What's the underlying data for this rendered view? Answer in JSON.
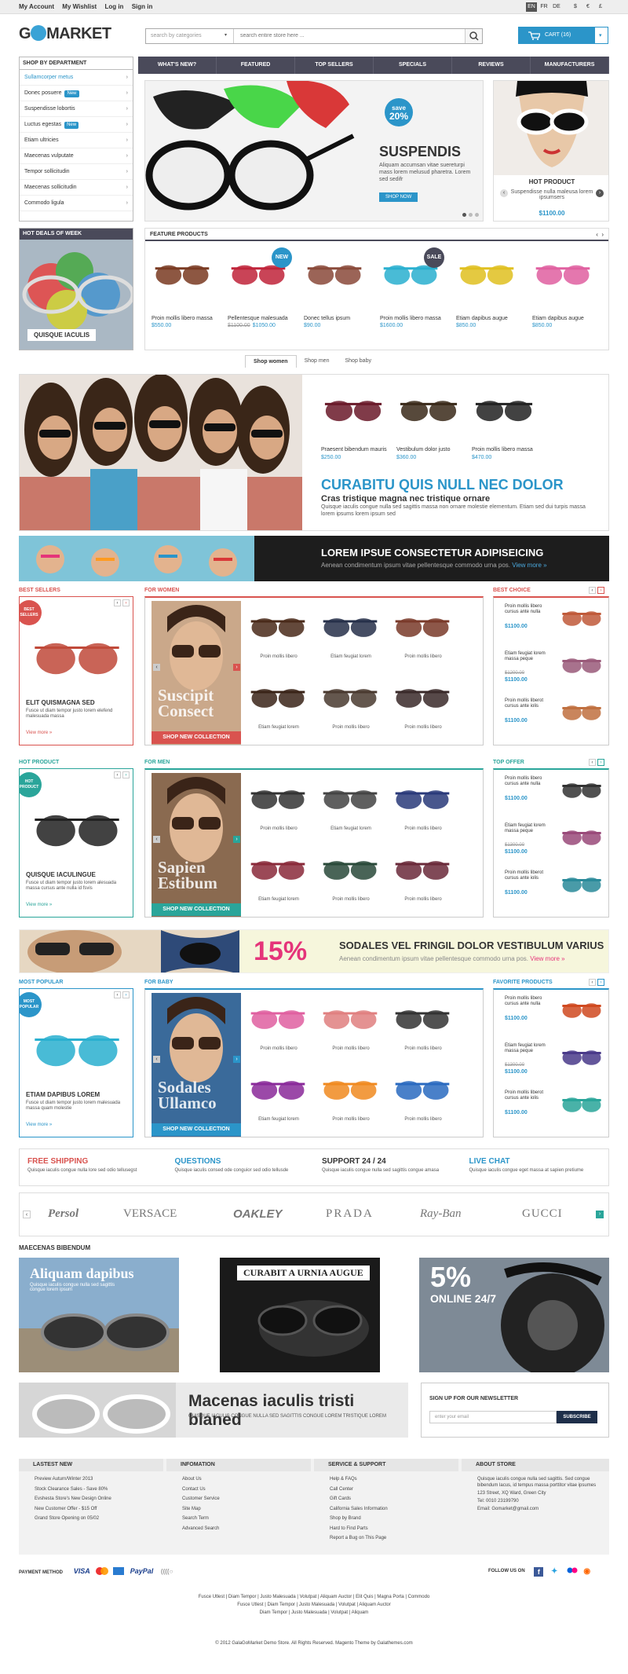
{
  "topbar": {
    "account": "My Account",
    "wishlist": "My Wishlist",
    "login": "Log in",
    "signin": "Sign in",
    "langs": [
      "EN",
      "FR",
      "DE"
    ],
    "currencies": [
      "$",
      "€",
      "£"
    ]
  },
  "logo": {
    "g": "G",
    "rest": "MARKET"
  },
  "search": {
    "category_placeholder": "search by categories",
    "placeholder": "search entire store here ..."
  },
  "cart": {
    "label": "CART (16)"
  },
  "dept": {
    "title": "SHOP BY DEPARTMENT",
    "items": [
      {
        "label": "Sullamcorper metus",
        "active": true,
        "badge": ""
      },
      {
        "label": "Donec posuere",
        "badge": "New"
      },
      {
        "label": "Suspendisse lobortis",
        "badge": ""
      },
      {
        "label": "Luctus egestas",
        "badge": "New"
      },
      {
        "label": "Etiam ultricies",
        "badge": ""
      },
      {
        "label": "Maecenas vulputate",
        "badge": ""
      },
      {
        "label": "Tempor sollicitudin",
        "badge": ""
      },
      {
        "label": "Maecenas sollicitudin",
        "badge": ""
      },
      {
        "label": "Commodo ligula",
        "badge": ""
      }
    ]
  },
  "nav": [
    "WHAT'S NEW?",
    "FEATURED",
    "TOP SELLERS",
    "SPECIALS",
    "REVIEWS",
    "MANUFACTURERS"
  ],
  "hero": {
    "save_top": "save",
    "save_pct": "20%",
    "title": "SUSPENDIS",
    "desc": "Aliquam accumsan vitae suereturpi mass lorem melusud pharetra. Lorem sed sedifr",
    "button": "SHOP NOW"
  },
  "hot_product": {
    "title": "HOT PRODUCT",
    "desc": "Suspendisse nulla maleusa lorem ipsumsers",
    "price": "$1100.00"
  },
  "hot_deals": {
    "title": "HOT DEALS OF WEEK",
    "caption": "QUISQUE IACULIS"
  },
  "feature": {
    "title": "FEATURE PRODUCTS",
    "products": [
      {
        "name": "Proin mollis libero massa",
        "price": "$550.00",
        "old": "",
        "badge": "",
        "color": "#7a3a22"
      },
      {
        "name": "Pellentesque malesuada",
        "price": "$1050.00",
        "old": "$1100.00",
        "badge": "NEW",
        "color": "#c0243a"
      },
      {
        "name": "Donec tellus ipsum",
        "price": "$90.00",
        "old": "",
        "badge": "",
        "color": "#8a4a3a"
      },
      {
        "name": "Proin mollis libero massa",
        "price": "$1600.00",
        "old": "",
        "badge": "SALE",
        "color": "#2ab0d0"
      },
      {
        "name": "Etiam dapibus augue",
        "price": "$850.00",
        "old": "",
        "badge": "",
        "color": "#e0c020"
      },
      {
        "name": "Etiam dapibus augue",
        "price": "$850.00",
        "old": "",
        "badge": "",
        "color": "#e060a0"
      }
    ]
  },
  "shop_tabs": [
    "Shop women",
    "Shop men",
    "Shop baby"
  ],
  "banner": {
    "products": [
      {
        "name": "Praesent bibendum mauris",
        "price": "$250.00"
      },
      {
        "name": "Vestibulum dolor justo",
        "price": "$360.00"
      },
      {
        "name": "Proin mollis libero massa",
        "price": "$470.00"
      }
    ],
    "title": "CURABITU QUIS NULL NEC DOLOR",
    "subtitle": "Cras tristique magna nec tristique ornare",
    "desc": "Quisque iaculis congue nulla sed sagittis massa non ornare molestie elementum. Etiam sed dui turpis massa lorem ipsums lorem ipsum sed"
  },
  "stripe": {
    "title": "LOREM IPSUE CONSECTETUR ADIPISEICING",
    "sub": "Aenean condimentum ipsum vitae pellentesque commodo urna pos.",
    "more": "View more »"
  },
  "sections": [
    {
      "left_label": "BEST SELLERS",
      "left_color": "#d9534f",
      "left_ribbon": "BEST SELLERS",
      "left_name": "ELIT QUISMAGNA SED",
      "left_desc": "Fusce ut diam tempor justo lorem elefend malesuada massa",
      "view": "View more »",
      "mid_label": "FOR WOMEN",
      "mid_caption": "Suscipit Consect",
      "mid_btn": "SHOP NEW COLLECTION",
      "grid": [
        "Proin mollis libero",
        "Etiam feugiat lorem",
        "Proin mollis libero",
        "Etiam feugiat lorem",
        "Proin mollis libero",
        "Proin mollis libero"
      ],
      "right_label": "BEST CHOICE",
      "side": [
        {
          "name": "Proin mollis libero cursus ante nulla",
          "old": "",
          "price": "$1100.00"
        },
        {
          "name": "Etiam feugiat lorem massa peque",
          "old": "$1200.00",
          "price": "$1100.00"
        },
        {
          "name": "Proin mollis liberot cursus ante iolis",
          "old": "",
          "price": "$1100.00"
        }
      ]
    },
    {
      "left_label": "HOT PRODUCT",
      "left_color": "#2aa59a",
      "left_ribbon": "HOT PRODUCT",
      "left_name": "QUISQUE IACULINGUE",
      "left_desc": "Fusce ut diam tempor justo lorem alesuada massa cursus ante nulla id fsvis",
      "view": "View more »",
      "mid_label": "FOR MEN",
      "mid_caption": "Sapien Estibum",
      "mid_btn": "SHOP NEW COLLECTION",
      "grid": [
        "Proin mollis libero",
        "Etiam feugiat lorem",
        "Proin mollis libero",
        "Etiam feugiat lorem",
        "Proin mollis libero",
        "Proin mollis libero"
      ],
      "right_label": "TOP OFFER",
      "side": [
        {
          "name": "Proin mollis libero cursus ante nulla",
          "old": "",
          "price": "$1100.00"
        },
        {
          "name": "Etiam feugiat lorem massa peque",
          "old": "$1300.00",
          "price": "$1100.00"
        },
        {
          "name": "Proin mollis liberot cursus ante iolis",
          "old": "",
          "price": "$1100.00"
        }
      ]
    },
    {
      "left_label": "MOST POPULAR",
      "left_color": "#2b95c9",
      "left_ribbon": "MOST POPULAR",
      "left_name": "ETIAM DAPIBUS LOREM",
      "left_desc": "Fusce ut diam tempor justo lorem malesuada massa quam molestie",
      "view": "View more »",
      "mid_label": "FOR BABY",
      "mid_caption": "Sodales Ullamco",
      "mid_btn": "SHOP NEW COLLECTION",
      "grid": [
        "Proin mollis libero",
        "Proin mollis libero",
        "Proin mollis libero",
        "Etiam feugiat lorem",
        "Proin mollis libero",
        "Proin mollis libero"
      ],
      "right_label": "FAVORITE PRODUCTS",
      "side": [
        {
          "name": "Proin mollis libero cursus ante nulla",
          "old": "",
          "price": "$1100.00"
        },
        {
          "name": "Etiam feugiat lorem massa peque",
          "old": "$1300.00",
          "price": "$1100.00"
        },
        {
          "name": "Proin mollis liberot cursus ante iolis",
          "old": "",
          "price": "$1100.00"
        }
      ]
    }
  ],
  "promo": {
    "pct": "15%",
    "title": "SODALES VEL FRINGIL DOLOR VESTIBULUM VARIUS",
    "sub": "Aenean condimentum ipsum vitae pellentesque commodo urna pos.",
    "more": "View more »"
  },
  "services": [
    {
      "t": "FREE SHIPPING",
      "d": "Quisque iaculis congue nulla lore sed odio tellusegst"
    },
    {
      "t": "QUESTIONS",
      "d": "Quisque iaculis consed ode  conguior sed odio tellusde"
    },
    {
      "t": "SUPPORT 24 / 24",
      "d": "Quisque iaculis congue nulla sed sagittis congue  amasa"
    },
    {
      "t": "LIVE CHAT",
      "d": "Quisque iaculis congue  eget massa at sapien pretiume"
    }
  ],
  "brands": [
    "Persol",
    "VERSACE",
    "OAKLEY",
    "PRADA",
    "Ray-Ban",
    "GUCCI"
  ],
  "maecenas": {
    "title": "MAECENAS BIBENDUM",
    "p1": "Aliquam dapibus",
    "p1d": "Quisque iaculis congue nulla sed sagittis congue lorem ipsum",
    "p2": "CURABIT A URNIA AUGUE",
    "p3a": "5%",
    "p3b": "ONLINE 24/7"
  },
  "macbar": {
    "title": "Macenas iaculis tristi blaned",
    "sub": "QUISQUE IACULIS CONGUE NULLA SED SAGITTIS CONGUE LOREM TRISTIQUE  LOREM"
  },
  "newsletter": {
    "title": "SIGN UP FOR OUR NEWSLETTER",
    "placeholder": "enter your email",
    "button": "SUBSCRIBE"
  },
  "footer": {
    "cols": [
      {
        "h": "LASTEST NEW",
        "items": [
          "Preview Auturn/Winter 2013",
          "Stock Clearance Sales - Save 80%",
          "Evshesta Store's New Design Online",
          "New Customer Offer - $15 Off",
          "Grand Store Opening on 05/02"
        ]
      },
      {
        "h": "INFOMATION",
        "items": [
          "About Us",
          "Contact Us",
          "Customer Service",
          "Site Map",
          "Search Term",
          "Advanced Search"
        ]
      },
      {
        "h": "SERVICE & SUPPORT",
        "items": [
          "Help & FAQs",
          "Call Center",
          "Gift Cards",
          "California Sales Information",
          "Shop by Brand",
          "Hard to Find Parts",
          "Report a Bug on This Page"
        ]
      },
      {
        "h": "ABOUT STORE",
        "text": "Quisque iaculis congue nulla sed sagittis. Sed congue bibendum lacus, id tempus massa porttitor vitae ipsumes",
        "addr": "123 Street, XQ Ward, Green City",
        "tel": "Tel: 0010 23199790",
        "email": "Email: Gomarket@gmail.com"
      }
    ]
  },
  "payment": {
    "label": "PAYMENT METHOD",
    "methods": [
      "VISA",
      "PayPal"
    ]
  },
  "follow": {
    "label": "FOLLOW US ON"
  },
  "footlinks": [
    "Fusce Utlest  |  Diam Tempor  |  Justo Malesuada  |  Volutpat  |  Aliquam Auctor  |  Elit Quis  |  Magna Porta  |  Commodo",
    "Fusce Utlest  |  Diam Tempor  |  Justo Malesuada  |  Volutpat  |  Aliquam Auctor",
    "Diam Tempor  |  Justo Malesuada  |  Volutpat  |  Aliquam"
  ],
  "copyright": "© 2012 GalaGoMarket Demo Store. All Rights Reserved. Magento Theme by Galathemes.com"
}
